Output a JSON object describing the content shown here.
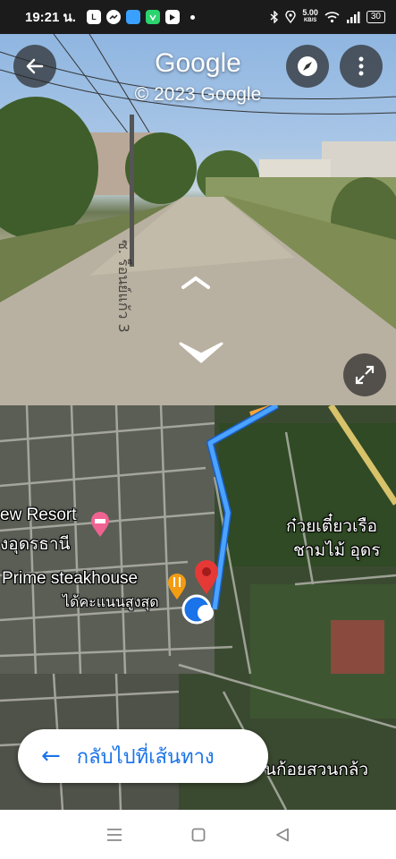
{
  "status_bar": {
    "time": "19:21 น.",
    "apps": [
      "LINE",
      "Messenger",
      "App",
      "LINE MAN",
      "YouTube"
    ],
    "speed_value": "5.00",
    "speed_unit": "KB/S",
    "battery": "30"
  },
  "street_view": {
    "title": "Google",
    "copyright": "© 2023 Google",
    "road_label": "ซ. ร็อนย์แก้ว 3",
    "icons": {
      "back": "arrow-left-icon",
      "compass": "compass-icon",
      "more": "more-vert-icon",
      "expand": "expand-icon"
    }
  },
  "map": {
    "labels": {
      "resort_line1": "ew Resort",
      "resort_line2": "งอุดรธานี",
      "steakhouse": "Prime steakhouse",
      "rating": "ได้คะแนนสูงสุด",
      "noodle_line1": "ก๋วยเตี๋ยวเรือ",
      "noodle_line2": "ชามไม้ อุดร",
      "bottom_place": "นก้อยสวนกล้ว"
    },
    "back_to_route": "กลับไปที่เส้นทาง",
    "colors": {
      "route": "#4aa3ff",
      "pin": "#e53935",
      "accent": "#1a73e8"
    }
  },
  "nav_bar": {
    "icons": [
      "menu-icon",
      "home-square-icon",
      "back-triangle-icon"
    ]
  }
}
